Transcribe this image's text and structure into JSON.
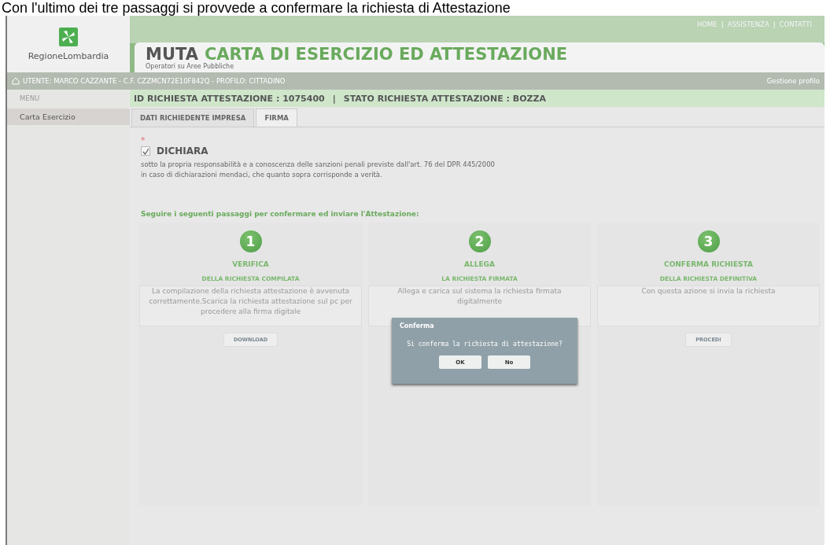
{
  "caption": "Con l'ultimo dei tre passaggi si provvede a confermare la richiesta di Attestazione",
  "header": {
    "nav": [
      {
        "kind": "link",
        "text": "HOME"
      },
      {
        "kind": "separator",
        "text": "|"
      },
      {
        "kind": "link",
        "text": "ASSISTENZA"
      },
      {
        "kind": "separator",
        "text": "|"
      },
      {
        "kind": "link",
        "text": "CONTATTI"
      }
    ],
    "logo_text": "RegioneLombardia",
    "title_prefix": "MUTA",
    "title": "CARTA DI ESERCIZIO ED ATTESTAZIONE",
    "subtitle": "Operatori su Aree Pubbliche"
  },
  "user_bar": {
    "text": "UTENTE: MARCO CAZZANTE - C.F. CZZMCN72E10F842Q - PROFILO: CITTADINO",
    "profile_link": "Gestione profilo"
  },
  "sidebar": {
    "heading": "MENU",
    "items": [
      {
        "label": "Carta Esercizio",
        "selected": true
      }
    ]
  },
  "status_bar": {
    "request_id": "ID RICHIESTA ATTESTAZIONE : 1075400",
    "separator": "|",
    "state": "STATO RICHIESTA ATTESTAZIONE : BOZZA"
  },
  "tabs": [
    {
      "label": "DATI RICHIEDENTE IMPRESA",
      "selected": false
    },
    {
      "label": "FIRMA",
      "selected": true
    }
  ],
  "declaration": {
    "required_mark": "*",
    "checked": true,
    "label": "DICHIARA",
    "text": "sotto la propria responsabilità e a conoscenza delle sanzioni penali previste dall'art. 76 del DPR 445/2000 in caso di dichiarazioni mendaci, che quanto sopra corrisponde a verità."
  },
  "instruction": "Seguire i seguenti passaggi per confermare ed inviare l'Attestazione:",
  "steps": [
    {
      "number": "1",
      "title": "VERIFICA",
      "subtitle": "DELLA RICHIESTA COMPILATA",
      "description": "La compilazione della richiesta attestazione è avvenuta correttamente.Scarica la richiesta attestazione sul pc per procedere alla firma digitale",
      "button": "DOWNLOAD"
    },
    {
      "number": "2",
      "title": "ALLEGA",
      "subtitle": "LA RICHIESTA FIRMATA",
      "description": "Allega e carica sul sistema la richiesta firmata digitalmente"
    },
    {
      "number": "3",
      "title": "CONFERMA RICHIESTA",
      "subtitle": "DELLA RICHIESTA DEFINITIVA",
      "description": "Con questa azione si invia la richiesta",
      "button": "PROCEDI"
    }
  ],
  "dialog": {
    "title": "Conferma",
    "message": "Si conferma la richiesta di attestazione?",
    "buttons": [
      "OK",
      "No"
    ]
  }
}
